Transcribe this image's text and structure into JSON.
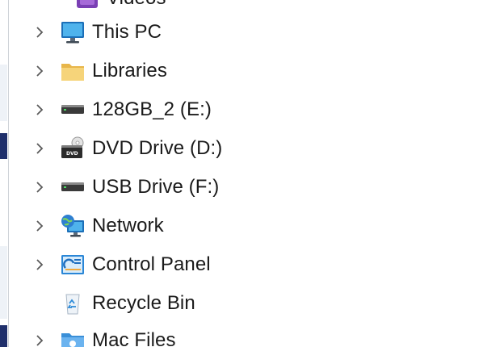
{
  "nav_tree": {
    "partial_top_label": "Videos",
    "items": [
      {
        "label": "This PC",
        "icon": "computer-monitor-icon",
        "expandable": true
      },
      {
        "label": "Libraries",
        "icon": "libraries-folder-icon",
        "expandable": true
      },
      {
        "label": "128GB_2 (E:)",
        "icon": "drive-icon",
        "expandable": true
      },
      {
        "label": "DVD Drive (D:)",
        "icon": "dvd-drive-icon",
        "expandable": true
      },
      {
        "label": "USB Drive (F:)",
        "icon": "usb-drive-icon",
        "expandable": true
      },
      {
        "label": "Network",
        "icon": "network-globe-icon",
        "expandable": true
      },
      {
        "label": "Control Panel",
        "icon": "control-panel-icon",
        "expandable": true
      },
      {
        "label": "Recycle Bin",
        "icon": "recycle-bin-icon",
        "expandable": false
      },
      {
        "label": "Mac Files",
        "icon": "mac-folder-icon",
        "expandable": true
      }
    ]
  },
  "colors": {
    "text": "#1a1a1a",
    "chevron": "#5a5a5a",
    "pane_border": "#cfd3d8",
    "selection_dark": "#1f2f6b"
  }
}
